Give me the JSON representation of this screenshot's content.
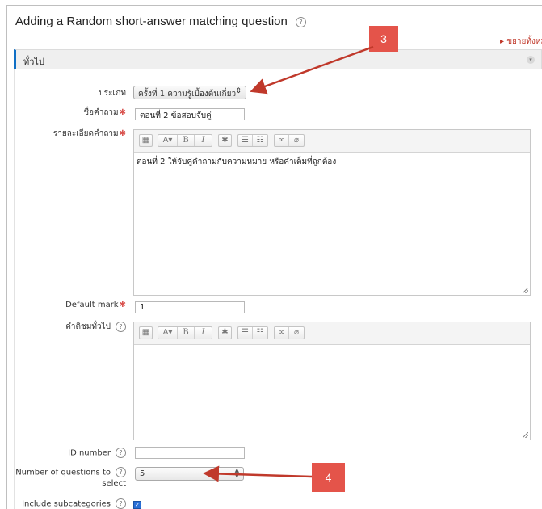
{
  "page": {
    "title": "Adding a Random short-answer matching question",
    "expand_all": "▸ ขยายทั้งหมด"
  },
  "section": {
    "title": "ทั่วไป"
  },
  "form": {
    "category": {
      "label": "ประเภท",
      "value": "ครั้งที่ 1 ความรู้เบื้องต้นเกี่ยว"
    },
    "name": {
      "label": "ชื่อคำถาม",
      "value": "ตอนที่ 2 ข้อสอบจับคู่"
    },
    "question_text": {
      "label": "รายละเอียดคำถาม",
      "value": "ตอนที่ 2 ให้จับคู่คำถามกับความหมาย หรือคำเต็มที่ถูกต้อง"
    },
    "default_mark": {
      "label": "Default mark",
      "value": "1"
    },
    "general_feedback": {
      "label": "คำติชมทั่วไป",
      "value": ""
    },
    "id_number": {
      "label": "ID number",
      "value": ""
    },
    "num_questions": {
      "label_line1": "Number of questions to",
      "label_line2": "select",
      "value": "5"
    },
    "include_subcategories": {
      "label": "Include subcategories",
      "checked": true
    }
  },
  "toolbar": {
    "buttons": [
      "▦",
      "A▾",
      "B",
      "I",
      "✱",
      "☰",
      "☷",
      "🔗",
      "⛓"
    ]
  },
  "callouts": {
    "first": "3",
    "second": "4"
  },
  "colors": {
    "accent": "#0f6fc5",
    "required": "#d9534f",
    "callout": "#e4544a",
    "arrow": "#c0392b"
  }
}
